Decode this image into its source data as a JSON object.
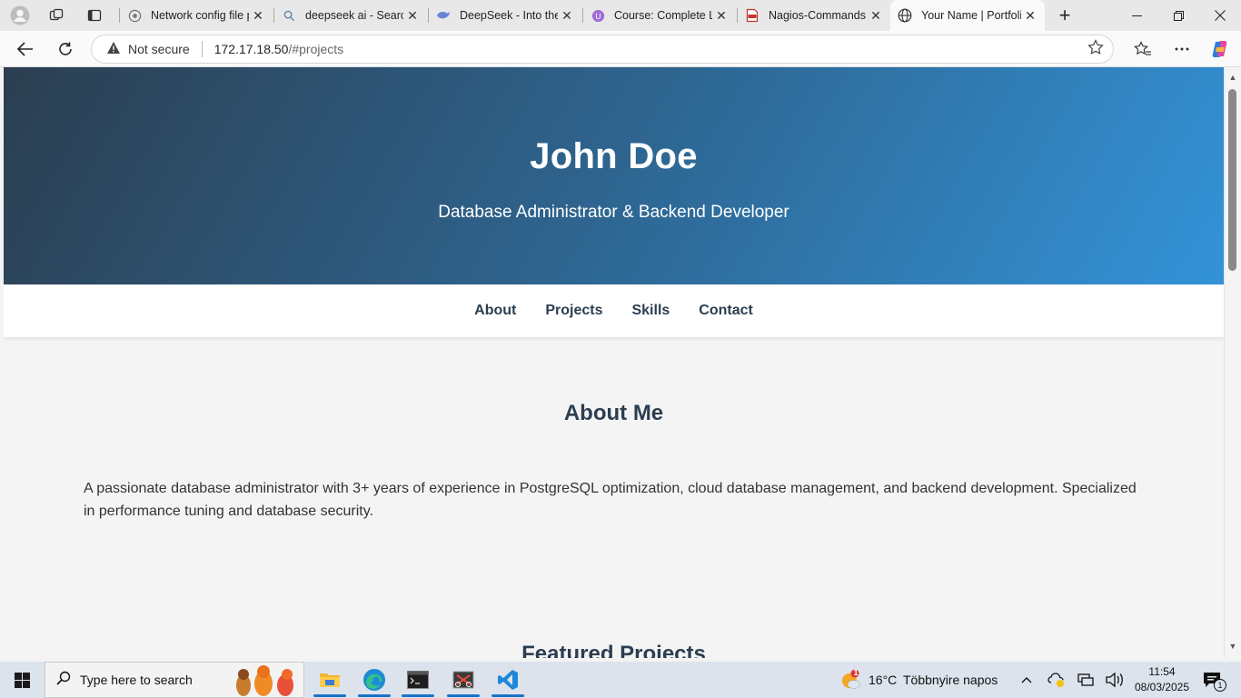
{
  "browser": {
    "tabs": [
      {
        "title": "Network config file p",
        "favicon": "globe-grey-icon"
      },
      {
        "title": "deepseek ai - Search",
        "favicon": "search-icon"
      },
      {
        "title": "DeepSeek - Into the",
        "favicon": "whale-icon"
      },
      {
        "title": "Course: Complete Li",
        "favicon": "course-icon"
      },
      {
        "title": "Nagios-Commands.p",
        "favicon": "pdf-icon"
      },
      {
        "title": "Your Name | Portfoli",
        "favicon": "globe-icon",
        "active": true
      }
    ],
    "new_tab_label": "+",
    "security_label": "Not secure",
    "url_host": "172.17.18.50",
    "url_path": "/#projects"
  },
  "site": {
    "hero_name": "John Doe",
    "hero_subtitle": "Database Administrator & Backend Developer",
    "nav": [
      "About",
      "Projects",
      "Skills",
      "Contact"
    ],
    "about_title": "About Me",
    "about_text": "A passionate database administrator with 3+ years of experience in PostgreSQL optimization, cloud database management, and backend development. Specialized in performance tuning and database security.",
    "projects_title": "Featured Projects"
  },
  "taskbar": {
    "search_placeholder": "Type here to search",
    "weather_temp": "16°C",
    "weather_desc": "Többnyire napos",
    "weather_badge": "1",
    "time": "11:54",
    "date": "08/03/2025",
    "notification_count": "1"
  },
  "colors": {
    "hero_start": "#2c3e50",
    "hero_end": "#3498db",
    "heading": "#2c3e50"
  }
}
